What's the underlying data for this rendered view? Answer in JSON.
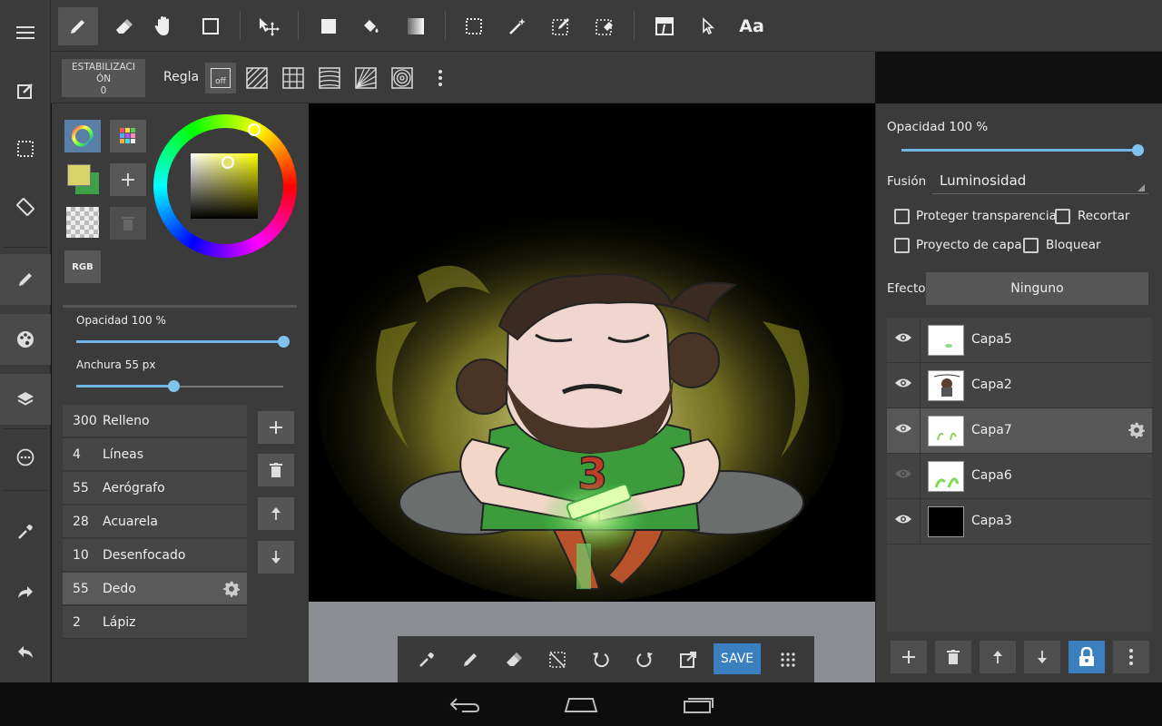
{
  "colors": {
    "panel": "#3b3b3b",
    "accent": "#3a7fbf",
    "slider": "#6fb4e4",
    "canvas_bg": "#000000",
    "foreground_color": "#d8d46a",
    "background_color": "#3ea04a"
  },
  "rail": {
    "items": [
      {
        "icon": "menu-icon"
      },
      {
        "icon": "edit-icon"
      },
      {
        "icon": "selection-icon"
      },
      {
        "icon": "rotate-screen-icon"
      },
      {
        "icon": "brush-panel-icon"
      },
      {
        "icon": "color-panel-icon"
      },
      {
        "icon": "layers-panel-icon"
      },
      {
        "icon": "more-circle-icon"
      },
      {
        "icon": "eyedropper-icon"
      },
      {
        "icon": "redo-icon"
      },
      {
        "icon": "undo-icon"
      }
    ]
  },
  "toolbar": {
    "tools": [
      {
        "icon": "pen-icon",
        "active": true
      },
      {
        "icon": "eraser-icon"
      },
      {
        "icon": "hand-icon"
      },
      {
        "icon": "shape-rect-icon"
      },
      {
        "icon": "move-icon"
      },
      {
        "icon": "fill-rect-icon"
      },
      {
        "icon": "bucket-icon"
      },
      {
        "icon": "gradient-icon"
      },
      {
        "icon": "select-rect-icon"
      },
      {
        "icon": "magic-wand-icon"
      },
      {
        "icon": "select-pen-icon"
      },
      {
        "icon": "select-eraser-icon"
      },
      {
        "icon": "frame-icon"
      },
      {
        "icon": "cursor-icon"
      }
    ],
    "text_tool_label": "Aa"
  },
  "subbar": {
    "stabilization_label": "ESTABILIZACIÓN",
    "stabilization_value": "0",
    "ruler_label": "Regla",
    "ruler_off_label": "off"
  },
  "color_panel": {
    "rgb_label": "RGB",
    "plus_label": "+"
  },
  "brush_settings": {
    "opacity_label": "Opacidad 100 %",
    "opacity_value": 1.0,
    "width_label": "Anchura 55 px",
    "width_value": 0.47
  },
  "brushes": [
    {
      "size": "300",
      "name": "Relleno"
    },
    {
      "size": "4",
      "name": "Líneas"
    },
    {
      "size": "55",
      "name": "Aerógrafo"
    },
    {
      "size": "28",
      "name": "Acuarela"
    },
    {
      "size": "10",
      "name": "Desenfocado"
    },
    {
      "size": "55",
      "name": "Dedo",
      "selected": true
    },
    {
      "size": "2",
      "name": "Lápiz"
    }
  ],
  "floatbar": {
    "save_label": "SAVE"
  },
  "layer_props": {
    "opacity_label": "Opacidad 100 %",
    "opacity_value": 1.0,
    "blend_label": "Fusión",
    "blend_value": "Luminosidad",
    "protect_label": "Proteger transparencia",
    "clip_label": "Recortar",
    "draft_label": "Proyecto de capa",
    "lock_label": "Bloquear",
    "effect_label": "Efecto",
    "effect_value": "Ninguno"
  },
  "layers": [
    {
      "name": "Capa5",
      "visible": true
    },
    {
      "name": "Capa2",
      "visible": true
    },
    {
      "name": "Capa7",
      "visible": true,
      "selected": true
    },
    {
      "name": "Capa6",
      "visible": false
    },
    {
      "name": "Capa3",
      "visible": true
    }
  ]
}
